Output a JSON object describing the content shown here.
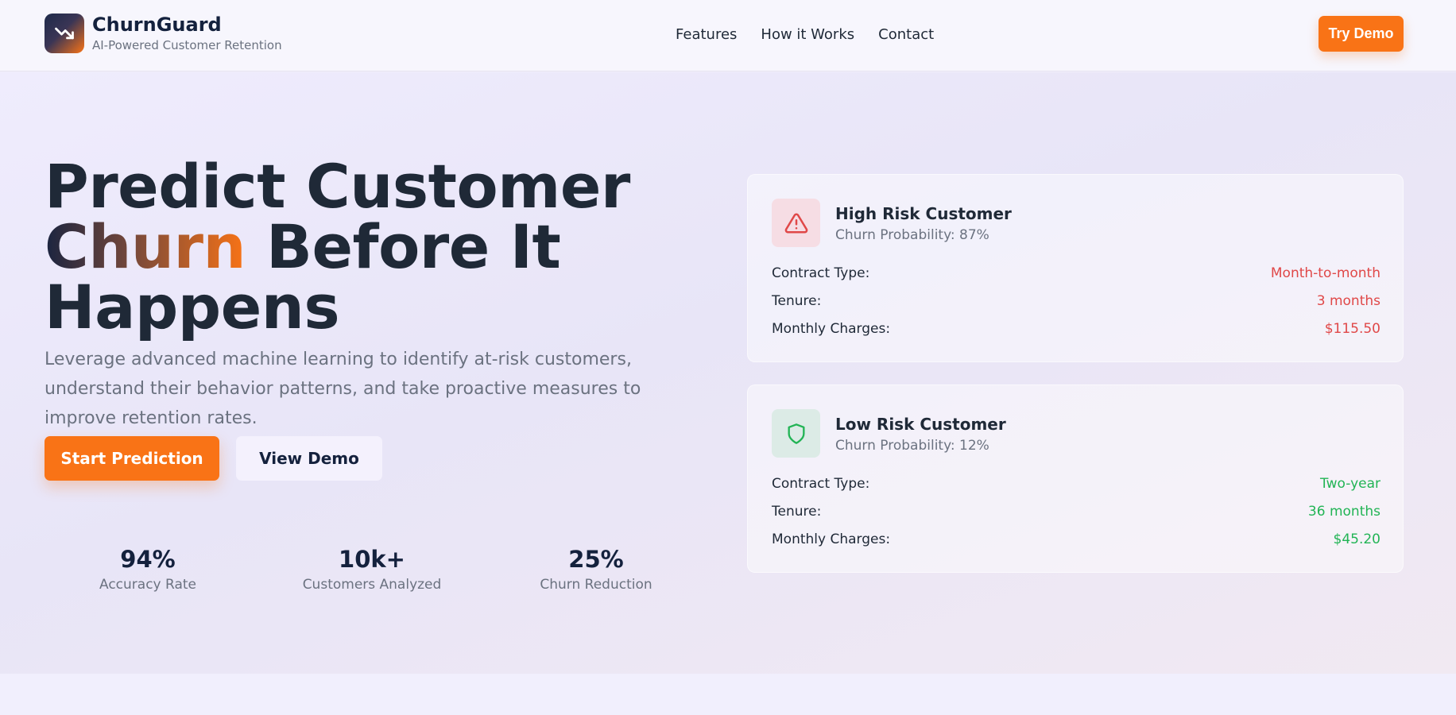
{
  "header": {
    "brand_name": "ChurnGuard",
    "tagline": "AI-Powered Customer Retention",
    "logo_icon": "trending-down-icon",
    "nav": [
      {
        "label": "Features"
      },
      {
        "label": "How it Works"
      },
      {
        "label": "Contact"
      }
    ],
    "cta_label": "Try Demo"
  },
  "hero": {
    "headline_line1": "Predict Customer",
    "headline_accent": "Churn",
    "headline_line2_rest": " Before It",
    "headline_line3": "Happens",
    "description": "Leverage advanced machine learning to identify at-risk customers, understand their behavior patterns, and take proactive measures to improve retention rates.",
    "primary_button": "Start Prediction",
    "secondary_button": "View Demo",
    "stats": [
      {
        "value": "94%",
        "label": "Accuracy Rate"
      },
      {
        "value": "10k+",
        "label": "Customers Analyzed"
      },
      {
        "value": "25%",
        "label": "Churn Reduction"
      }
    ]
  },
  "cards": [
    {
      "icon": "alert-triangle-icon",
      "title": "High Risk Customer",
      "subtitle": "Churn Probability: 87%",
      "rows": [
        {
          "label": "Contract Type:",
          "value": "Month-to-month"
        },
        {
          "label": "Tenure:",
          "value": "3 months"
        },
        {
          "label": "Monthly Charges:",
          "value": "$115.50"
        }
      ]
    },
    {
      "icon": "shield-icon",
      "title": "Low Risk Customer",
      "subtitle": "Churn Probability: 12%",
      "rows": [
        {
          "label": "Contract Type:",
          "value": "Two-year"
        },
        {
          "label": "Tenure:",
          "value": "36 months"
        },
        {
          "label": "Monthly Charges:",
          "value": "$45.20"
        }
      ]
    }
  ],
  "colors": {
    "brand_navy": "#14213d",
    "accent_orange": "#f97316",
    "risk_high": "#e04848",
    "risk_low": "#22b455",
    "muted_text": "#6b7280"
  }
}
